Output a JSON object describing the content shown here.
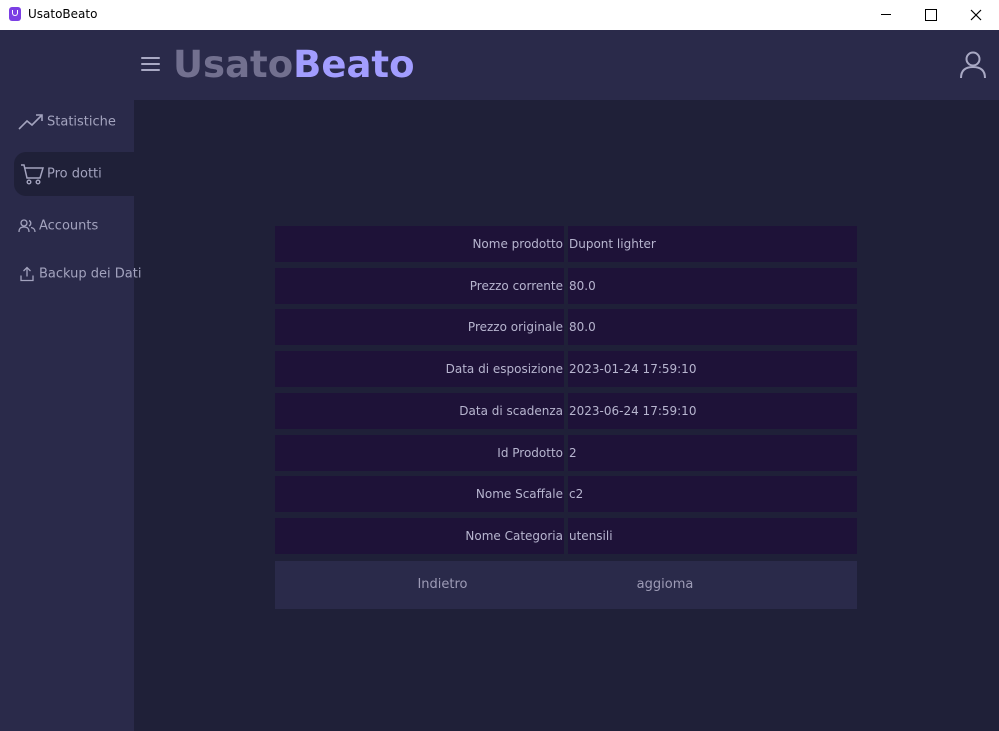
{
  "window": {
    "title": "UsatoBeato"
  },
  "header": {
    "brand_part1": "Usato",
    "brand_part2": "Beato"
  },
  "sidebar": {
    "items": [
      {
        "label": "Statistiche",
        "icon": "trend-up-icon"
      },
      {
        "label": "Pro dotti",
        "icon": "cart-icon",
        "active": true
      },
      {
        "label": "Accounts",
        "icon": "users-icon"
      },
      {
        "label": "Backup dei Dati",
        "icon": "upload-icon"
      }
    ]
  },
  "product": {
    "rows": [
      {
        "label": "Nome prodotto",
        "value": "Dupont lighter"
      },
      {
        "label": "Prezzo corrente",
        "value": "80.0"
      },
      {
        "label": "Prezzo originale",
        "value": "80.0"
      },
      {
        "label": "Data di esposizione",
        "value": "2023-01-24 17:59:10"
      },
      {
        "label": "Data di scadenza",
        "value": "2023-06-24 17:59:10"
      },
      {
        "label": "Id Prodotto",
        "value": "2"
      },
      {
        "label": "Nome Scaffale",
        "value": "c2"
      },
      {
        "label": "Nome Categoria",
        "value": "utensili"
      }
    ]
  },
  "actions": {
    "back_label": "Indietro",
    "update_label": "aggioma"
  },
  "colors": {
    "accent": "#a29dff",
    "sidebar_bg": "#2a2a4a",
    "content_bg": "#1f2038",
    "cell_bg": "#1e1238"
  }
}
